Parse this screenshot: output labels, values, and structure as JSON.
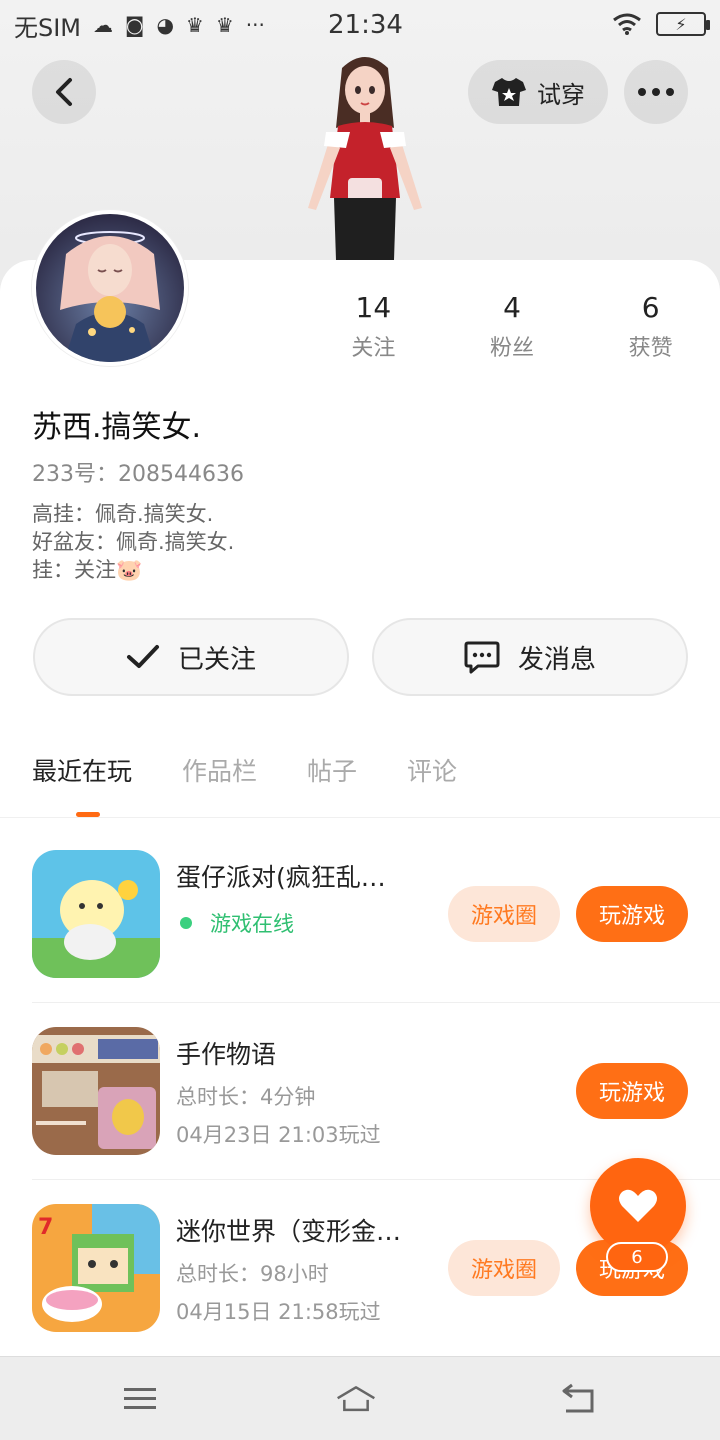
{
  "status_bar": {
    "carrier": "无SIM",
    "time": "21:34",
    "icons": [
      "cloud-icon",
      "media-icon",
      "game-icon",
      "crown-icon",
      "crown-icon",
      "more-icon"
    ],
    "right_icons": [
      "wifi-icon",
      "battery-charging-icon"
    ]
  },
  "header": {
    "try_on_label": "试穿"
  },
  "profile": {
    "nickname": "苏西.搞笑女.",
    "uid": "233号：208544636",
    "bio_lines": [
      "高挂：佩奇.搞笑女.",
      "好盆友：佩奇.搞笑女.",
      "挂：关注🐷"
    ],
    "stats": [
      {
        "value": "14",
        "label": "关注"
      },
      {
        "value": "4",
        "label": "粉丝"
      },
      {
        "value": "6",
        "label": "获赞"
      }
    ]
  },
  "actions": {
    "follow_label": "已关注",
    "message_label": "发消息"
  },
  "tabs": [
    {
      "label": "最近在玩",
      "active": true
    },
    {
      "label": "作品栏",
      "active": false
    },
    {
      "label": "帖子",
      "active": false
    },
    {
      "label": "评论",
      "active": false
    }
  ],
  "games": [
    {
      "name": "蛋仔派对(疯狂乱…",
      "status": "游戏在线",
      "circle_label": "游戏圈",
      "play_label": "玩游戏"
    },
    {
      "name": "手作物语",
      "duration": "总时长：4分钟",
      "last_played": "04月23日 21:03玩过",
      "play_label": "玩游戏"
    },
    {
      "name": "迷你世界（变形金…",
      "duration": "总时长：98小时",
      "last_played": "04月15日 21:58玩过",
      "circle_label": "游戏圈",
      "play_label": "玩游戏"
    }
  ],
  "like_fab": {
    "count": "6"
  },
  "colors": {
    "accent": "#ff6510",
    "online": "#2fbf71",
    "circle_bg": "#fde6d8"
  }
}
